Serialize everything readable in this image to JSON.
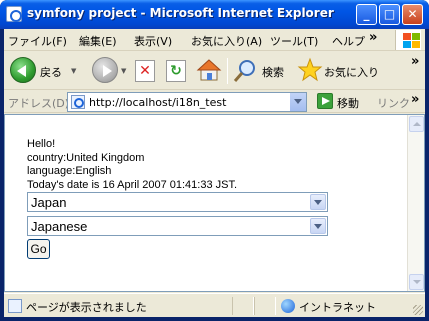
{
  "window": {
    "title": "symfony project - Microsoft Internet Explorer",
    "controls": {
      "minimize": "_",
      "maximize": "□",
      "close": "✕"
    }
  },
  "menubar": {
    "items": [
      "ファイル(F)",
      "編集(E)",
      "表示(V)",
      "お気に入り(A)",
      "ツール(T)",
      "ヘルプ"
    ],
    "more": "»"
  },
  "toolbar": {
    "back_label": "戻る",
    "search_label": "検索",
    "favorites_label": "お気に入り",
    "more": "»",
    "stop_glyph": "✕",
    "refresh_glyph": "↻"
  },
  "addressbar": {
    "label": "アドレス(D)",
    "url": "http://localhost/i18n_test",
    "go_label": "移動",
    "links_label": "リンク",
    "more": "»"
  },
  "content": {
    "greeting": "Hello!",
    "country_line": "country:United Kingdom",
    "language_line": "language:English",
    "date_line": "Today's date is 16 April 2007 01:41:33 JST.",
    "country_select": {
      "selected": "Japan"
    },
    "language_select": {
      "selected": "Japanese"
    },
    "go_button": "Go"
  },
  "statusbar": {
    "text": "ページが表示されました",
    "zone": "イントラネット"
  }
}
